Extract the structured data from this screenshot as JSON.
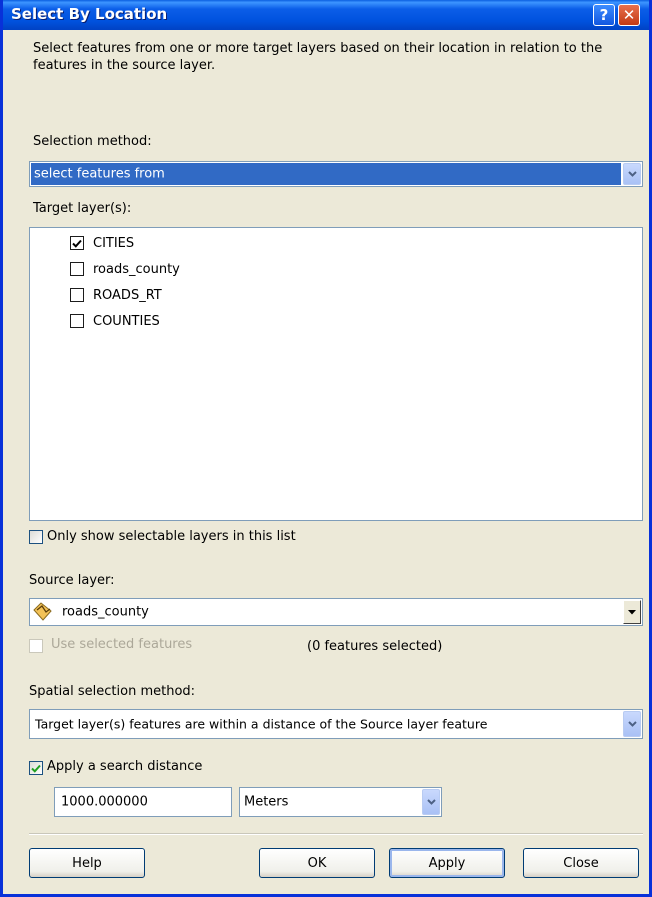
{
  "window": {
    "title": "Select By Location",
    "help_button": "?",
    "close_button": "✕"
  },
  "description": "Select features from one or more target layers based on their location in relation to the features in the source layer.",
  "selection_method": {
    "label": "Selection method:",
    "value": "select features from"
  },
  "target_layers": {
    "label": "Target layer(s):",
    "items": [
      {
        "name": "CITIES",
        "checked": true
      },
      {
        "name": "roads_county",
        "checked": false
      },
      {
        "name": "ROADS_RT",
        "checked": false
      },
      {
        "name": "COUNTIES",
        "checked": false
      }
    ]
  },
  "only_selectable": {
    "label": "Only show selectable layers in this list",
    "checked": false
  },
  "source_layer": {
    "label": "Source layer:",
    "value": "roads_county",
    "icon": "line-layer-icon"
  },
  "use_selected": {
    "label": "Use selected features",
    "checked": false,
    "enabled": false,
    "count_text": "(0 features selected)"
  },
  "spatial_method": {
    "label": "Spatial selection method:",
    "value": "Target layer(s) features are within a distance of the Source layer feature"
  },
  "search_distance": {
    "label": "Apply a search distance",
    "checked": true,
    "value": "1000.000000",
    "unit": "Meters"
  },
  "buttons": {
    "help": "Help",
    "ok": "OK",
    "apply": "Apply",
    "close": "Close"
  },
  "colors": {
    "titlebar": "#0052de",
    "dialog_bg": "#ece9d8",
    "selection": "#316ac5",
    "checkmark_green": "#21a121"
  }
}
